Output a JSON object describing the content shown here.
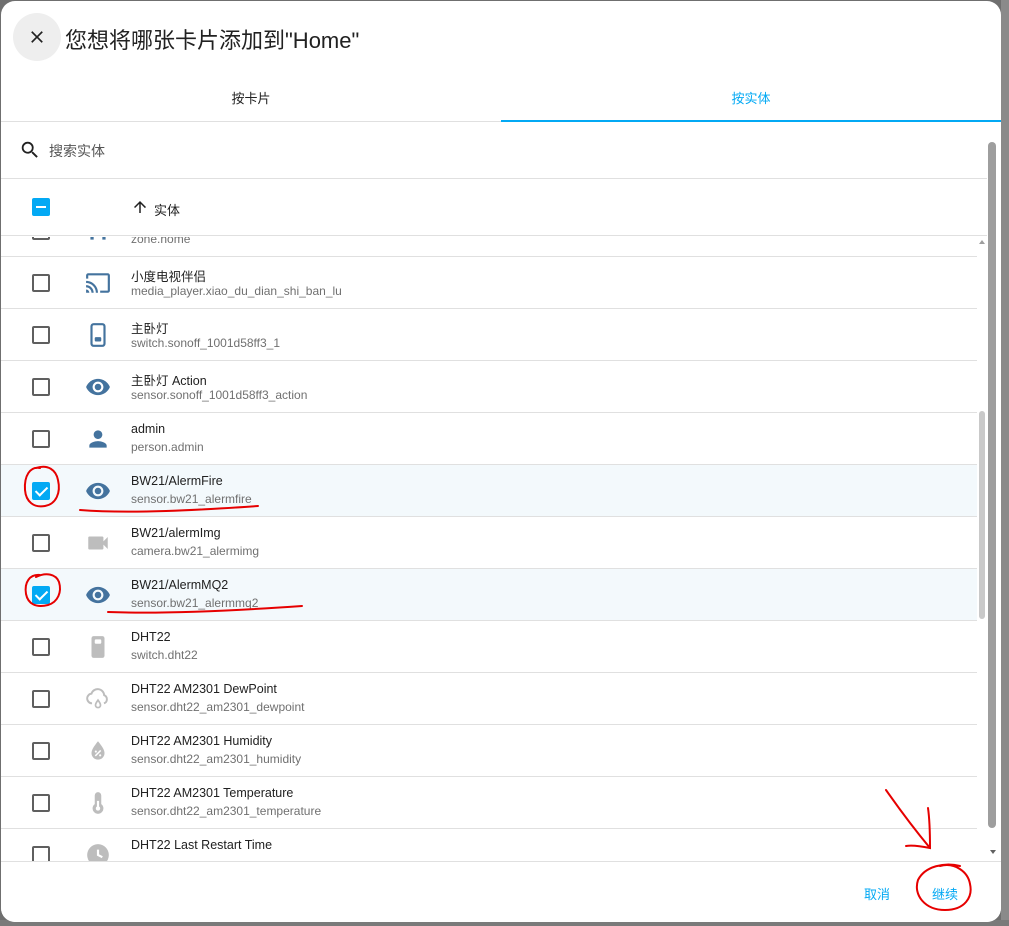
{
  "dialog": {
    "title": "您想将哪张卡片添加到\"Home\""
  },
  "tabs": [
    {
      "label": "按卡片",
      "active": false
    },
    {
      "label": "按实体",
      "active": true
    }
  ],
  "search": {
    "placeholder": "搜索实体"
  },
  "table": {
    "column_label": "实体"
  },
  "rows": [
    {
      "name": "",
      "entity_id": "zone.home",
      "icon": "zone-icon",
      "checked": false
    },
    {
      "name": "小度电视伴侣",
      "entity_id": "media_player.xiao_du_dian_shi_ban_lu",
      "icon": "cast-icon",
      "checked": false
    },
    {
      "name": "主卧灯",
      "entity_id": "switch.sonoff_1001d58ff3_1",
      "icon": "switch-device-icon",
      "checked": false
    },
    {
      "name": "主卧灯 Action",
      "entity_id": "sensor.sonoff_1001d58ff3_action",
      "icon": "eye-icon",
      "checked": false
    },
    {
      "name": "admin",
      "entity_id": "person.admin",
      "icon": "person-icon",
      "checked": false
    },
    {
      "name": "BW21/AlermFire",
      "entity_id": "sensor.bw21_alermfire",
      "icon": "eye-icon",
      "checked": true
    },
    {
      "name": "BW21/alermImg",
      "entity_id": "camera.bw21_alermimg",
      "icon": "camera-icon",
      "checked": false
    },
    {
      "name": "BW21/AlermMQ2",
      "entity_id": "sensor.bw21_alermmq2",
      "icon": "eye-icon",
      "checked": true
    },
    {
      "name": "DHT22",
      "entity_id": "switch.dht22",
      "icon": "switch-off-icon",
      "checked": false
    },
    {
      "name": "DHT22 AM2301 DewPoint",
      "entity_id": "sensor.dht22_am2301_dewpoint",
      "icon": "dewpoint-icon",
      "checked": false
    },
    {
      "name": "DHT22 AM2301 Humidity",
      "entity_id": "sensor.dht22_am2301_humidity",
      "icon": "humidity-icon",
      "checked": false
    },
    {
      "name": "DHT22 AM2301 Temperature",
      "entity_id": "sensor.dht22_am2301_temperature",
      "icon": "thermometer-icon",
      "checked": false
    },
    {
      "name": "DHT22 Last Restart Time",
      "entity_id": "",
      "icon": "clock-icon",
      "checked": false
    }
  ],
  "footer": {
    "cancel_label": "取消",
    "continue_label": "继续"
  },
  "colors": {
    "accent": "#03a9f4",
    "icon_active": "#44739e",
    "icon_inactive": "#9e9e9e",
    "annotation": "#e60000"
  }
}
